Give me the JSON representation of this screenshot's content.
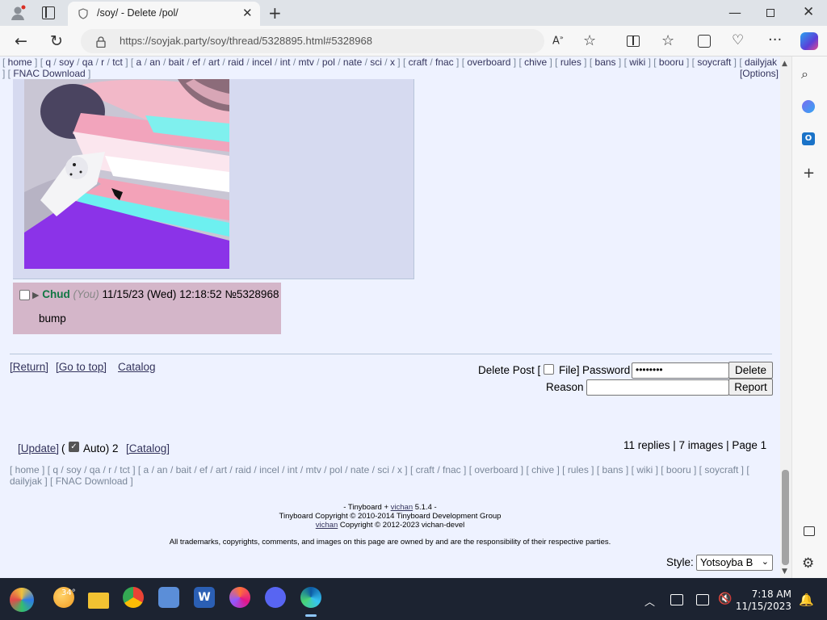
{
  "browser": {
    "tab_title": "/soy/ - Delete /pol/",
    "url": "https://soyjak.party/soy/thread/5328895.html#5328968"
  },
  "boardlist": {
    "groups": [
      [
        "home"
      ],
      [
        "q",
        "soy",
        "qa",
        "r",
        "tct"
      ],
      [
        "a",
        "an",
        "bait",
        "ef",
        "art",
        "raid",
        "incel",
        "int",
        "mtv",
        "pol",
        "nate",
        "sci",
        "x"
      ],
      [
        "craft",
        "fnac"
      ],
      [
        "overboard"
      ],
      [
        "chive"
      ],
      [
        "rules"
      ],
      [
        "bans"
      ],
      [
        "wiki"
      ],
      [
        "booru"
      ],
      [
        "soycraft"
      ],
      [
        "dailyjak"
      ],
      [
        "FNAC Download"
      ]
    ],
    "options_label": "[Options]"
  },
  "reply": {
    "name": "Chud",
    "you": "(You)",
    "date": "11/15/23 (Wed) 12:18:52",
    "number": "№5328968",
    "body": "bump"
  },
  "thread_links": {
    "return": "[Return]",
    "top": "[Go to top]",
    "catalog": "Catalog"
  },
  "delete_form": {
    "delete_post": "Delete Post [",
    "file": "File]",
    "password_label": "Password",
    "password_value": "••••••••",
    "delete_button": "Delete",
    "reason_label": "Reason",
    "report_button": "Report"
  },
  "update": {
    "update_link": "[Update]",
    "open_paren": "(",
    "auto_label": "Auto) 2",
    "catalog_link": "[Catalog]",
    "stats": "11 replies | 7 images | Page 1"
  },
  "footer": {
    "line1_pre": "- Tinyboard + ",
    "line1_link": "vichan",
    "line1_post": " 5.1.4 -",
    "line2": "Tinyboard Copyright © 2010-2014 Tinyboard Development Group",
    "line3_link": "vichan",
    "line3_post": " Copyright © 2012-2023 vichan-devel",
    "line4": "All trademarks, copyrights, comments, and images on this page are owned by and are the responsibility of their respective parties.",
    "style_label": "Style:",
    "style_value": "Yotsoyba B"
  },
  "taskbar": {
    "weather": "34°",
    "time": "7:18 AM",
    "date": "11/15/2023"
  },
  "colors": {
    "page_bg": "#eef2ff",
    "op_bg": "#d6daf0",
    "reply_bg": "#d4b6c9",
    "name_color": "#117743",
    "link_color": "#34345c"
  }
}
